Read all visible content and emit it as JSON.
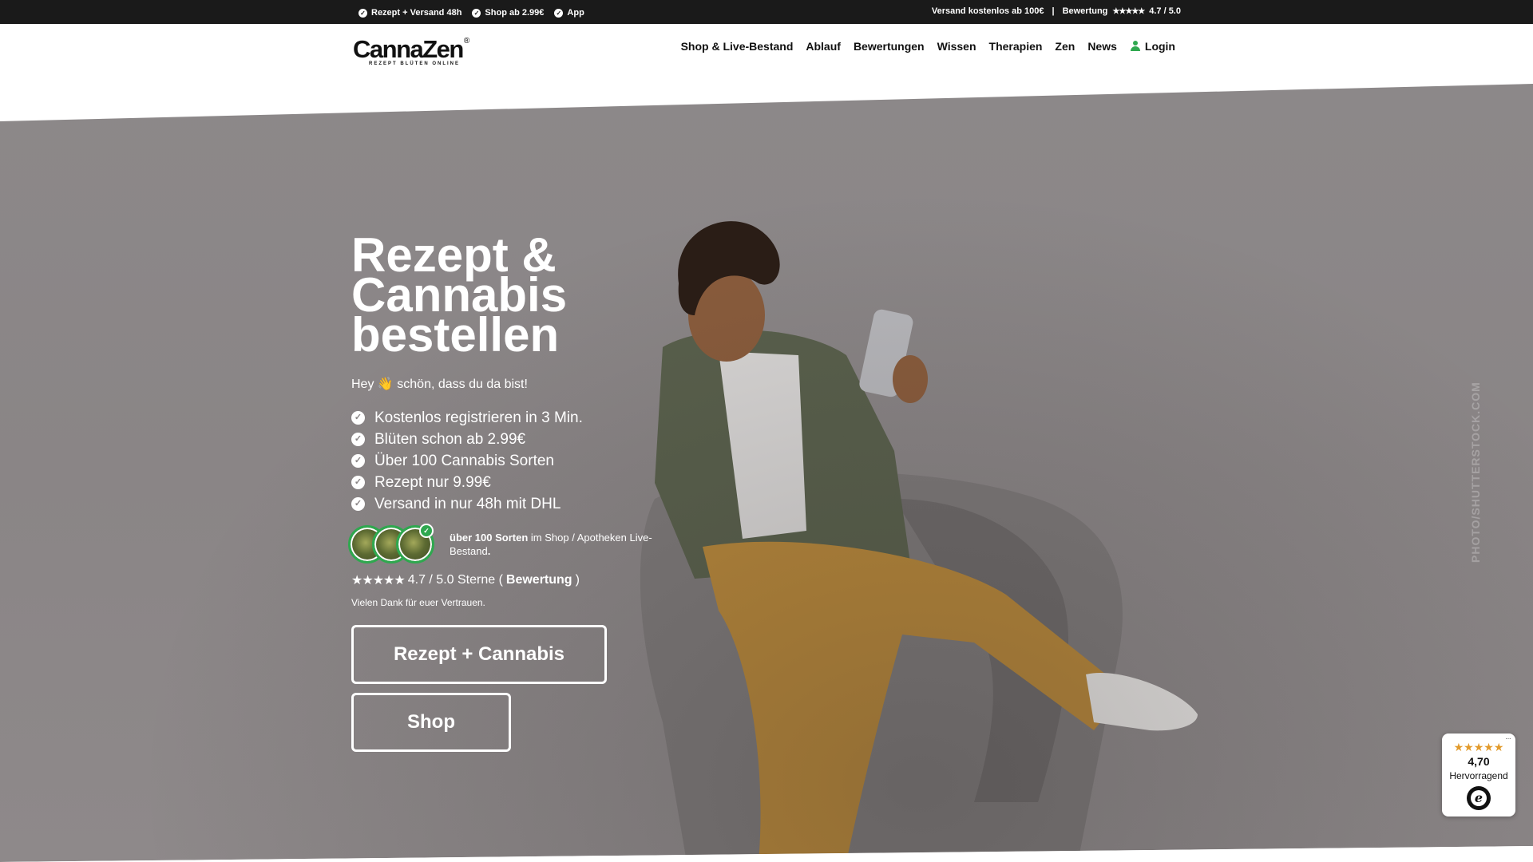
{
  "topbar": {
    "left_items": [
      "Rezept + Versand 48h",
      "Shop ab 2.99€",
      "App"
    ],
    "shipping": "Versand kostenlos ab 100€",
    "separator": "|",
    "rating_label": "Bewertung",
    "rating_stars": "★★★★★",
    "rating_value": "4.7 / 5.0"
  },
  "header": {
    "logo_name": "CannaZen",
    "logo_reg": "®",
    "logo_tagline": "REZEPT BLÜTEN ONLINE",
    "nav": [
      "Shop & Live-Bestand",
      "Ablauf",
      "Bewertungen",
      "Wissen",
      "Therapien",
      "Zen",
      "News"
    ],
    "login": "Login"
  },
  "hero": {
    "title_lines": [
      "Rezept &",
      "Cannabis",
      "bestellen"
    ],
    "greeting": "Hey 👋 schön, dass du da bist!",
    "features": [
      "Kostenlos registrieren in 3 Min.",
      "Blüten schon ab 2.99€",
      "Über 100 Cannabis Sorten",
      "Rezept nur 9.99€",
      "Versand in nur 48h mit DHL"
    ],
    "sorten_bold": "über 100 Sorten",
    "sorten_rest": "im Shop / Apotheken Live-Bestand",
    "sorten_end": ".",
    "rating_stars": "★★★★★",
    "rating_text": "4.7 / 5.0 Sterne (",
    "rating_bold": "Bewertung",
    "rating_close": ")",
    "thanks": "Vielen Dank für euer Vertrauen.",
    "btn_primary": "Rezept + Cannabis",
    "btn_shop": "Shop",
    "watermark": "PHOTO/SHUTTERSTOCK.COM"
  },
  "trust_badge": {
    "stars": "★★★★★",
    "score": "4,70",
    "label": "Hervorragend",
    "seal_letter": "e",
    "menu": "···"
  },
  "colors": {
    "accent_green": "#2fa84f",
    "topbar_bg": "#1a1a1a",
    "star_orange": "#e29a2b"
  }
}
